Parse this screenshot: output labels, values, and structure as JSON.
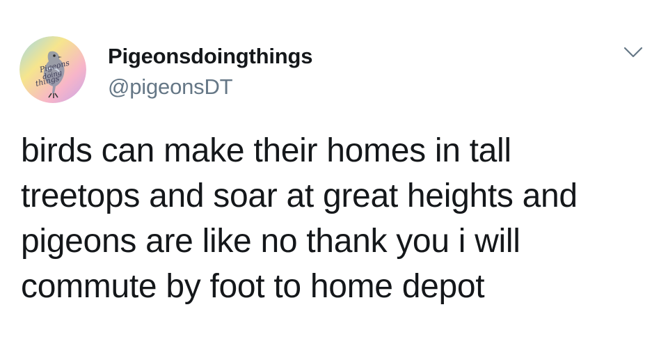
{
  "tweet": {
    "user": {
      "display_name": "Pigeonsdoingthings",
      "handle": "@pigeonsDT",
      "avatar_icon": "pigeon-avatar-icon",
      "avatar_text": "Pigeons doing things"
    },
    "menu_icon": "chevron-down-icon",
    "text_lines": [
      "birds can make their homes in tall",
      "treetops and soar at great heights and",
      "pigeons are like no thank you i will",
      "commute by foot to home depot"
    ]
  },
  "colors": {
    "text_primary": "#14171a",
    "text_secondary": "#657786",
    "background": "#ffffff"
  }
}
